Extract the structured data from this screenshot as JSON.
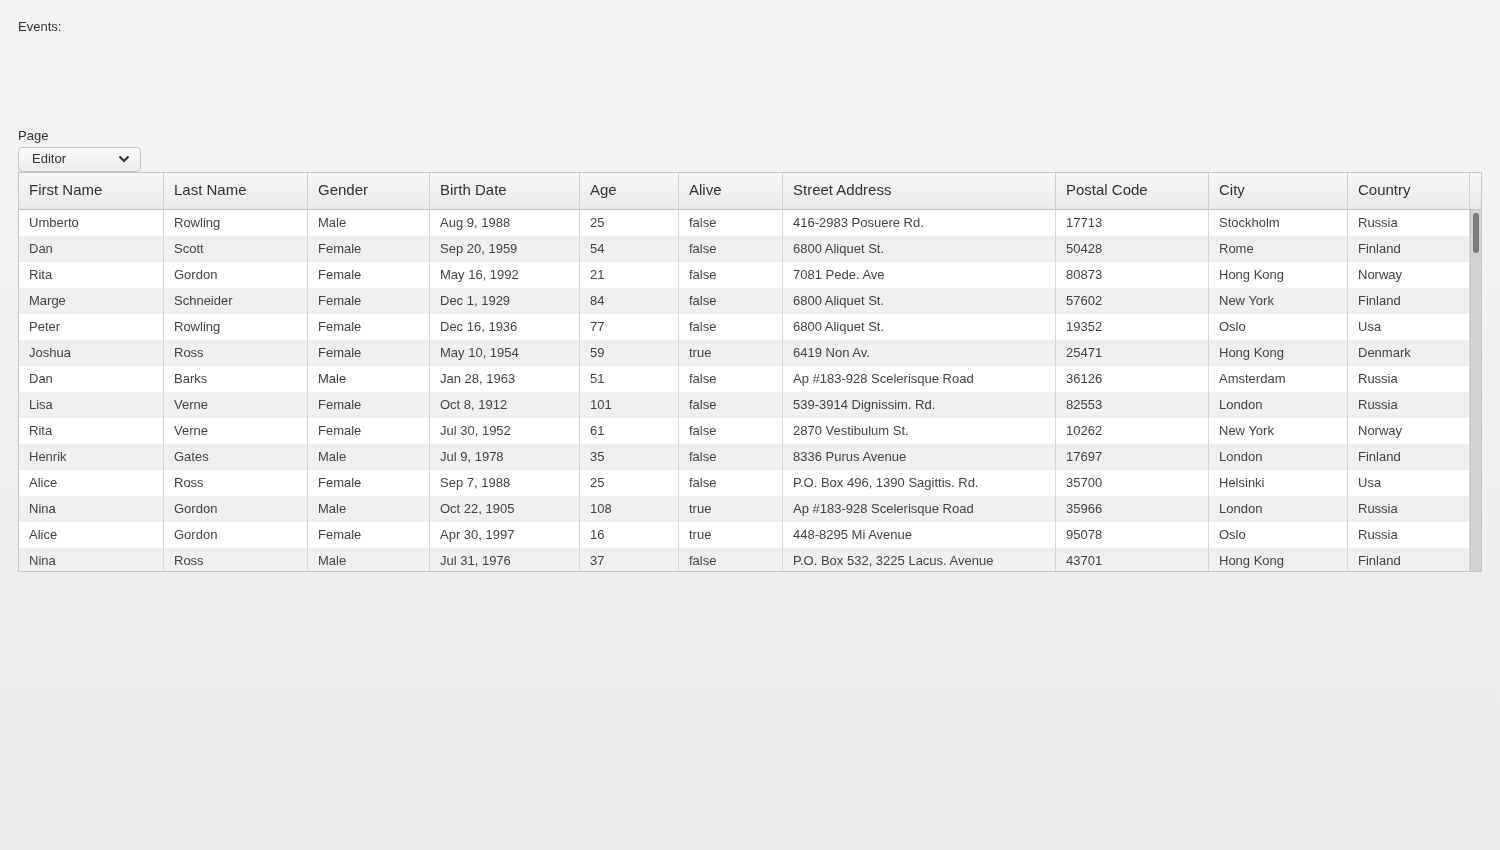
{
  "events_label": "Events:",
  "page_select": {
    "label": "Page",
    "value": "Editor"
  },
  "table": {
    "columns": [
      "First Name",
      "Last Name",
      "Gender",
      "Birth Date",
      "Age",
      "Alive",
      "Street Address",
      "Postal Code",
      "City",
      "Country"
    ],
    "rows": [
      [
        "Umberto",
        "Rowling",
        "Male",
        "Aug 9, 1988",
        "25",
        "false",
        "416-2983 Posuere Rd.",
        "17713",
        "Stockholm",
        "Russia"
      ],
      [
        "Dan",
        "Scott",
        "Female",
        "Sep 20, 1959",
        "54",
        "false",
        "6800 Aliquet St.",
        "50428",
        "Rome",
        "Finland"
      ],
      [
        "Rita",
        "Gordon",
        "Female",
        "May 16, 1992",
        "21",
        "false",
        "7081 Pede. Ave",
        "80873",
        "Hong Kong",
        "Norway"
      ],
      [
        "Marge",
        "Schneider",
        "Female",
        "Dec 1, 1929",
        "84",
        "false",
        "6800 Aliquet St.",
        "57602",
        "New York",
        "Finland"
      ],
      [
        "Peter",
        "Rowling",
        "Female",
        "Dec 16, 1936",
        "77",
        "false",
        "6800 Aliquet St.",
        "19352",
        "Oslo",
        "Usa"
      ],
      [
        "Joshua",
        "Ross",
        "Female",
        "May 10, 1954",
        "59",
        "true",
        "6419 Non Av.",
        "25471",
        "Hong Kong",
        "Denmark"
      ],
      [
        "Dan",
        "Barks",
        "Male",
        "Jan 28, 1963",
        "51",
        "false",
        "Ap #183-928 Scelerisque Road",
        "36126",
        "Amsterdam",
        "Russia"
      ],
      [
        "Lisa",
        "Verne",
        "Female",
        "Oct 8, 1912",
        "101",
        "false",
        "539-3914 Dignissim. Rd.",
        "82553",
        "London",
        "Russia"
      ],
      [
        "Rita",
        "Verne",
        "Female",
        "Jul 30, 1952",
        "61",
        "false",
        "2870 Vestibulum St.",
        "10262",
        "New York",
        "Norway"
      ],
      [
        "Henrik",
        "Gates",
        "Male",
        "Jul 9, 1978",
        "35",
        "false",
        "8336 Purus Avenue",
        "17697",
        "London",
        "Finland"
      ],
      [
        "Alice",
        "Ross",
        "Female",
        "Sep 7, 1988",
        "25",
        "false",
        "P.O. Box 496, 1390 Sagittis. Rd.",
        "35700",
        "Helsinki",
        "Usa"
      ],
      [
        "Nina",
        "Gordon",
        "Male",
        "Oct 22, 1905",
        "108",
        "true",
        "Ap #183-928 Scelerisque Road",
        "35966",
        "London",
        "Russia"
      ],
      [
        "Alice",
        "Gordon",
        "Female",
        "Apr 30, 1997",
        "16",
        "true",
        "448-8295 Mi Avenue",
        "95078",
        "Oslo",
        "Russia"
      ],
      [
        "Nina",
        "Ross",
        "Male",
        "Jul 31, 1976",
        "37",
        "false",
        "P.O. Box 532, 3225 Lacus. Avenue",
        "43701",
        "Hong Kong",
        "Finland"
      ]
    ]
  }
}
